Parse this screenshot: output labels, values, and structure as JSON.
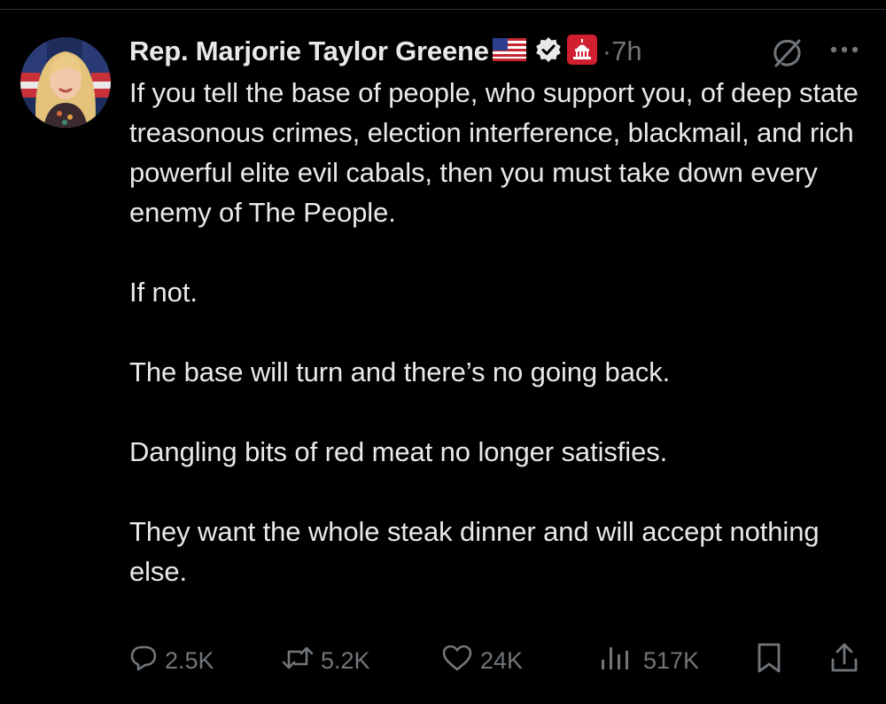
{
  "author": {
    "display_name": "Rep. Marjorie Taylor Greene",
    "flag_icon": "us-flag-icon",
    "verified_icon": "verified-badge-icon",
    "affiliation_icon": "capitol-affiliation-icon",
    "timestamp": "·7h"
  },
  "post": {
    "paragraphs": [
      "If you tell the base of people, who support you, of deep state treasonous crimes, election interference, blackmail, and rich powerful elite evil cabals, then you must take down every enemy of The People.",
      "If not.",
      "The base will turn and there’s no going back.",
      "Dangling bits of red meat no longer satisfies.",
      "They want the whole steak dinner and will accept nothing else."
    ]
  },
  "actions": {
    "replies": "2.5K",
    "reposts": "5.2K",
    "likes": "24K",
    "views": "517K"
  },
  "colors": {
    "background": "#000000",
    "text": "#e7e9ea",
    "muted": "#71767b",
    "verified": "#e7e9ea",
    "affiliation": "#d0202f"
  }
}
